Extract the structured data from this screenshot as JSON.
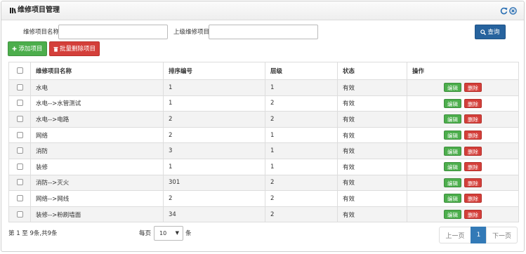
{
  "panel": {
    "title": "维修项目管理"
  },
  "search": {
    "name_label": "维修项目名称",
    "name_value": "",
    "parent_label": "上级维修项目",
    "parent_value": "",
    "query_label": "查询"
  },
  "toolbar": {
    "add_label": "添加项目",
    "batch_delete_label": "批量删除项目"
  },
  "table": {
    "headers": [
      "维修项目名称",
      "排序编号",
      "层级",
      "状态",
      "操作"
    ],
    "edit_label": "编辑",
    "delete_label": "删除",
    "rows": [
      {
        "name": "水电",
        "order": "1",
        "level": "1",
        "status": "有效"
      },
      {
        "name": "水电-->水管测试",
        "order": "1",
        "level": "2",
        "status": "有效"
      },
      {
        "name": "水电-->电路",
        "order": "2",
        "level": "2",
        "status": "有效"
      },
      {
        "name": "网络",
        "order": "2",
        "level": "1",
        "status": "有效"
      },
      {
        "name": "消防",
        "order": "3",
        "level": "1",
        "status": "有效"
      },
      {
        "name": "装修",
        "order": "1",
        "level": "1",
        "status": "有效"
      },
      {
        "name": "消防-->灭火",
        "order": "301",
        "level": "2",
        "status": "有效"
      },
      {
        "name": "网络-->网线",
        "order": "2",
        "level": "2",
        "status": "有效"
      },
      {
        "name": "装修-->粉刷墙面",
        "order": "34",
        "level": "2",
        "status": "有效"
      }
    ]
  },
  "pagination": {
    "info": "第 1 至 9条,共9条",
    "per_page_prefix": "每页",
    "per_page_value": "10",
    "per_page_suffix": "条",
    "prev_label": "上一页",
    "current_page": "1",
    "next_label": "下一页"
  },
  "colors": {
    "primary": "#27639e",
    "success": "#4cae4c",
    "danger": "#d43f3a",
    "active_page": "#337ab7"
  }
}
